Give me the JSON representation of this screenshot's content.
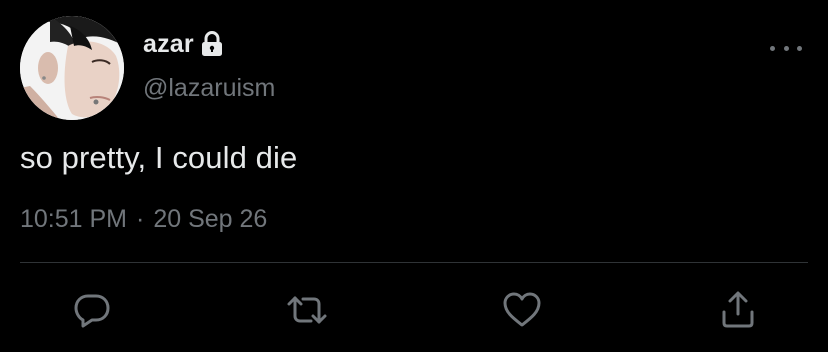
{
  "tweet": {
    "display_name": "azar",
    "handle": "@lazaruism",
    "text": "so pretty, I could die",
    "time": "10:51 PM",
    "separator": "·",
    "date": "20 Sep 26",
    "protected_icon": "lock-icon",
    "more_icon": "more-horizontal-icon"
  },
  "actions": [
    {
      "name": "reply",
      "icon": "reply-icon"
    },
    {
      "name": "retweet",
      "icon": "retweet-icon"
    },
    {
      "name": "like",
      "icon": "heart-icon"
    },
    {
      "name": "share",
      "icon": "share-icon"
    }
  ],
  "colors": {
    "background": "#000000",
    "primary_text": "#e7e9ea",
    "secondary_text": "#71767b",
    "divider": "#2f3336"
  }
}
